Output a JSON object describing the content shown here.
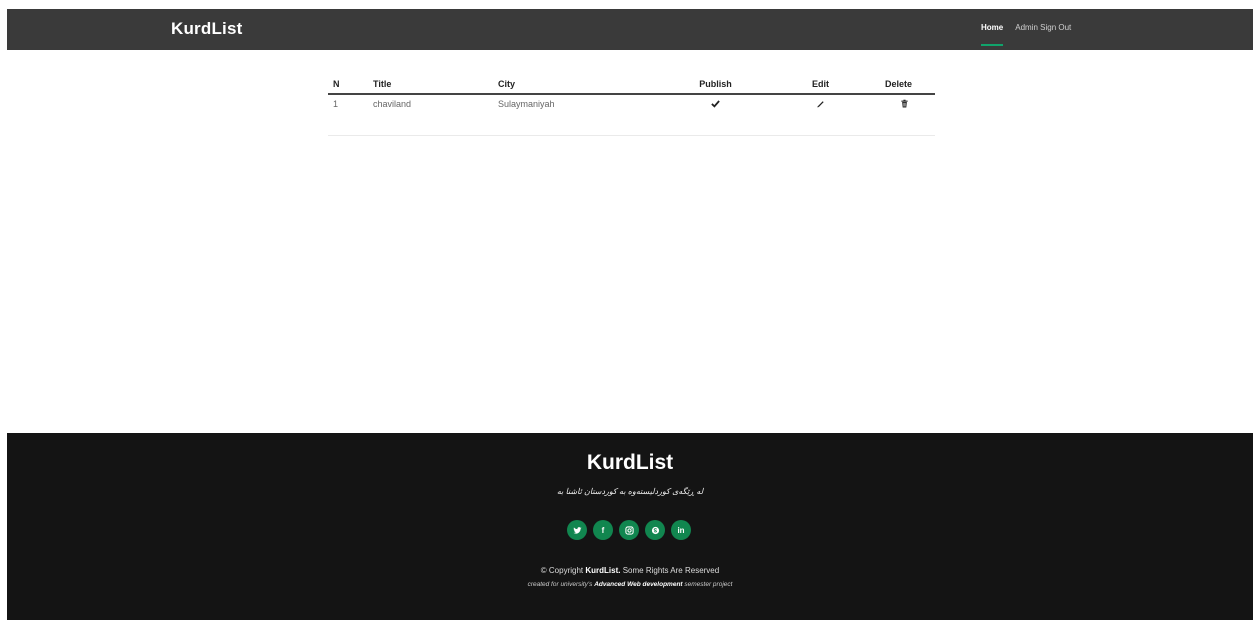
{
  "header": {
    "logo": "KurdList",
    "nav": [
      {
        "label": "Home"
      },
      {
        "label": "Admin Sign Out"
      }
    ]
  },
  "table": {
    "columns": [
      "N",
      "Title",
      "City",
      "Publish",
      "Edit",
      "Delete"
    ],
    "rows": [
      {
        "n": "1",
        "title": "chaviland",
        "city": "Sulaymaniyah",
        "publish_icon": "check-icon",
        "edit_icon": "pencil-icon",
        "delete_icon": "trash-icon"
      }
    ]
  },
  "footer": {
    "logo": "KurdList",
    "tagline": "لە ڕێگەی کوردلیستەوە بە کوردستان ئاشنا بە",
    "socials": [
      {
        "name": "twitter-icon",
        "glyph": "🐦"
      },
      {
        "name": "facebook-icon",
        "glyph": "f"
      },
      {
        "name": "instagram-icon",
        "glyph": "◎"
      },
      {
        "name": "skype-icon",
        "glyph": "S"
      },
      {
        "name": "linkedin-icon",
        "glyph": "in"
      }
    ],
    "copyright_prefix": "© Copyright",
    "copyright_brand": "KurdList.",
    "copyright_suffix": "Some Rights Are Reserved",
    "credit_prefix": "created for university's",
    "credit_emph": "Advanced Web development",
    "credit_suffix": "semester project"
  },
  "colors": {
    "header_bg": "#3a3a3a",
    "footer_bg": "#141414",
    "accent": "#11864f"
  }
}
